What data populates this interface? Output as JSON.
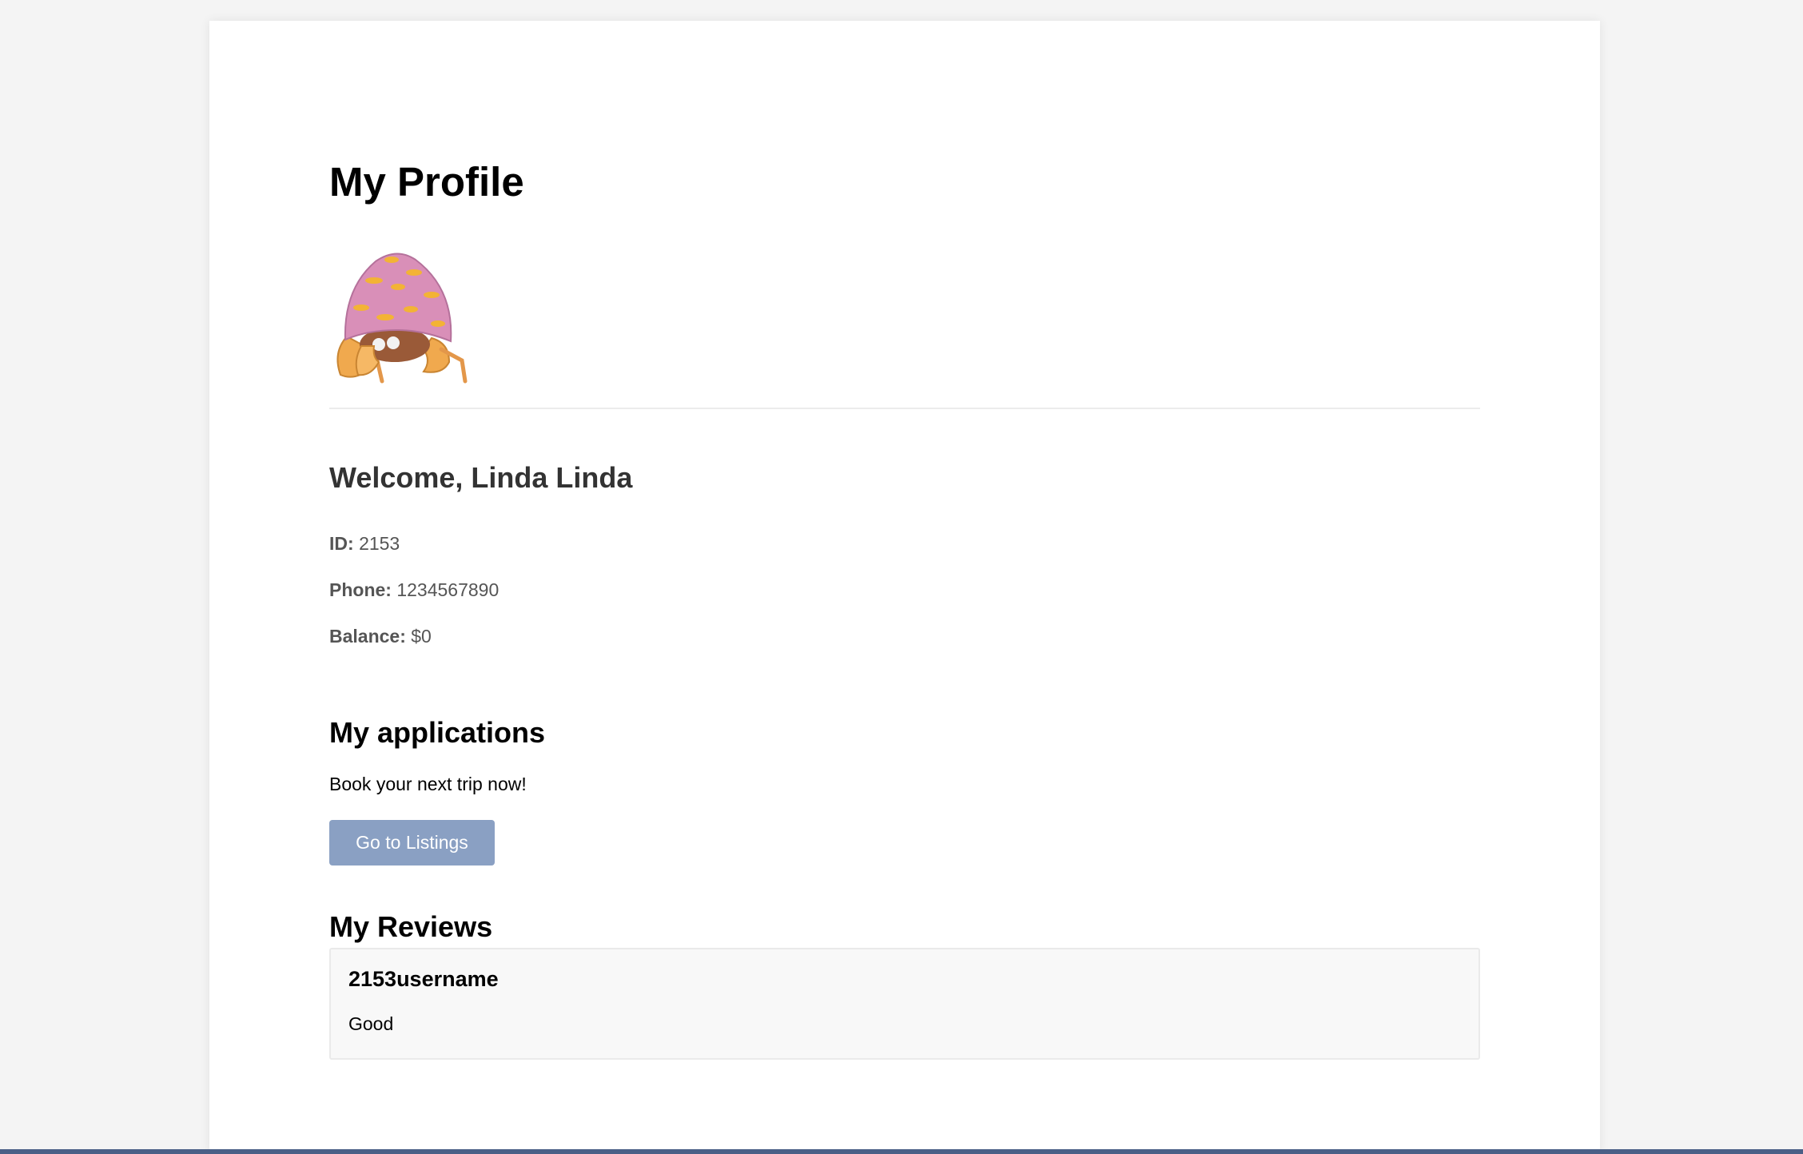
{
  "profile": {
    "title": "My Profile",
    "avatar_icon": "hermit-crab-mushroom-avatar"
  },
  "user": {
    "welcome": "Welcome, Linda Linda",
    "id_label": "ID:",
    "id_value": "2153",
    "phone_label": "Phone:",
    "phone_value": "1234567890",
    "balance_label": "Balance:",
    "balance_value": "$0"
  },
  "applications": {
    "title": "My applications",
    "text": "Book your next trip now!",
    "button_label": "Go to Listings",
    "button_color": "#8aa0c3"
  },
  "reviews": {
    "title": "My Reviews",
    "items": [
      {
        "username": "2153username",
        "text": "Good"
      }
    ]
  }
}
